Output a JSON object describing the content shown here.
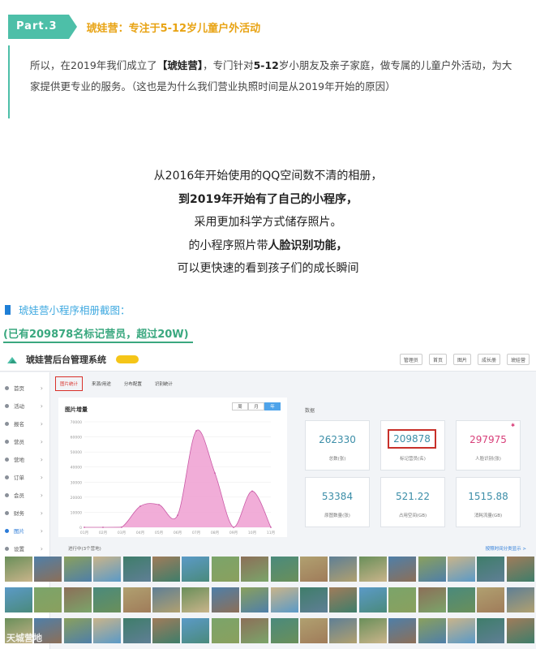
{
  "part": {
    "tag": "Part.3",
    "title": "琥娃营：专注于5-12岁儿童户外活动"
  },
  "intro": {
    "text_1": "所以，在2019年我们成立了",
    "brand": "【琥娃营】",
    "text_2": "，专门针对",
    "age": "5-12",
    "text_3": "岁小朋友及亲子家庭，做专属的儿童户外活动，为大家提供更专业的服务。（这也是为什么我们营业执照时间是从2019年开始的原因）"
  },
  "center": {
    "line1": "从2016年开始使用的QQ空间数不清的相册，",
    "line2": "到2019年开始有了自己的小程序，",
    "line3": "采用更加科学方式储存照片。",
    "line4a": "的小程序照片带",
    "line4b": "人脸识别功能，",
    "line5": "可以更快速的看到孩子们的成长瞬间"
  },
  "caption": {
    "text": "琥娃营小程序相册截图：",
    "stat": "(已有209878名标记营员，超过20W)"
  },
  "admin": {
    "system_title": "琥娃营后台管理系统",
    "top_buttons": [
      "管理员",
      "首页",
      "图片",
      "成长册",
      "琥娃营"
    ],
    "sidebar": [
      {
        "label": "首页",
        "active": false
      },
      {
        "label": "活动",
        "active": false
      },
      {
        "label": "报名",
        "active": false
      },
      {
        "label": "营员",
        "active": false
      },
      {
        "label": "营地",
        "active": false
      },
      {
        "label": "订单",
        "active": false
      },
      {
        "label": "会员",
        "active": false
      },
      {
        "label": "财务",
        "active": false
      },
      {
        "label": "图片",
        "active": true
      },
      {
        "label": "设置",
        "active": false
      },
      {
        "label": "其他",
        "active": false
      }
    ],
    "tabs": [
      {
        "label": "图片统计",
        "active": true
      },
      {
        "label": "来源/用途",
        "active": false
      },
      {
        "label": "分布配置",
        "active": false
      },
      {
        "label": "识别统计",
        "active": false
      }
    ],
    "chart_title": "图片增量",
    "period": [
      "周",
      "月",
      "年"
    ],
    "stats_title": "数据",
    "stats": [
      {
        "value": "262330",
        "label": "总数(张)",
        "style": "normal"
      },
      {
        "value": "209878",
        "label": "标记营员(名)",
        "style": "highlight"
      },
      {
        "value": "297975",
        "label": "人脸识别(张)",
        "style": "pink"
      },
      {
        "value": "53384",
        "label": "原图数量(张)",
        "style": "normal"
      },
      {
        "value": "521.22",
        "label": "占用空间(GB)",
        "style": "normal"
      },
      {
        "value": "1515.88",
        "label": "消耗流量(GB)",
        "style": "normal"
      }
    ],
    "bottom_left": "进行中(3个营地)",
    "bottom_right": "按照时间分类显示 >",
    "watermark": "天城营地"
  },
  "chart_data": {
    "type": "area",
    "title": "图片增量",
    "categories": [
      "01月",
      "02月",
      "03月",
      "04月",
      "05月",
      "06月",
      "07月",
      "08月",
      "09月",
      "10月",
      "11月"
    ],
    "values": [
      0,
      0,
      100,
      14000,
      15000,
      8000,
      64000,
      36000,
      0,
      24000,
      0
    ],
    "y_ticks": [
      0,
      10000,
      20000,
      30000,
      40000,
      50000,
      60000,
      70000
    ],
    "ylim": [
      0,
      70000
    ],
    "color": "#ee9fd1"
  }
}
